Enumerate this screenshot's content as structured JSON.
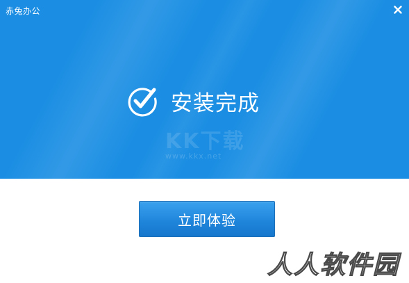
{
  "window": {
    "title": "赤兔办公",
    "close_icon": "close-icon"
  },
  "hero": {
    "status_icon": "check-circle-icon",
    "status_text": "安装完成",
    "background_color": "#1b8ee3",
    "watermark_logo": "KK下载",
    "watermark_url": "www.kkx.net"
  },
  "actions": {
    "primary_label": "立即体验"
  },
  "overlay": {
    "site_watermark": "人人软件园"
  }
}
